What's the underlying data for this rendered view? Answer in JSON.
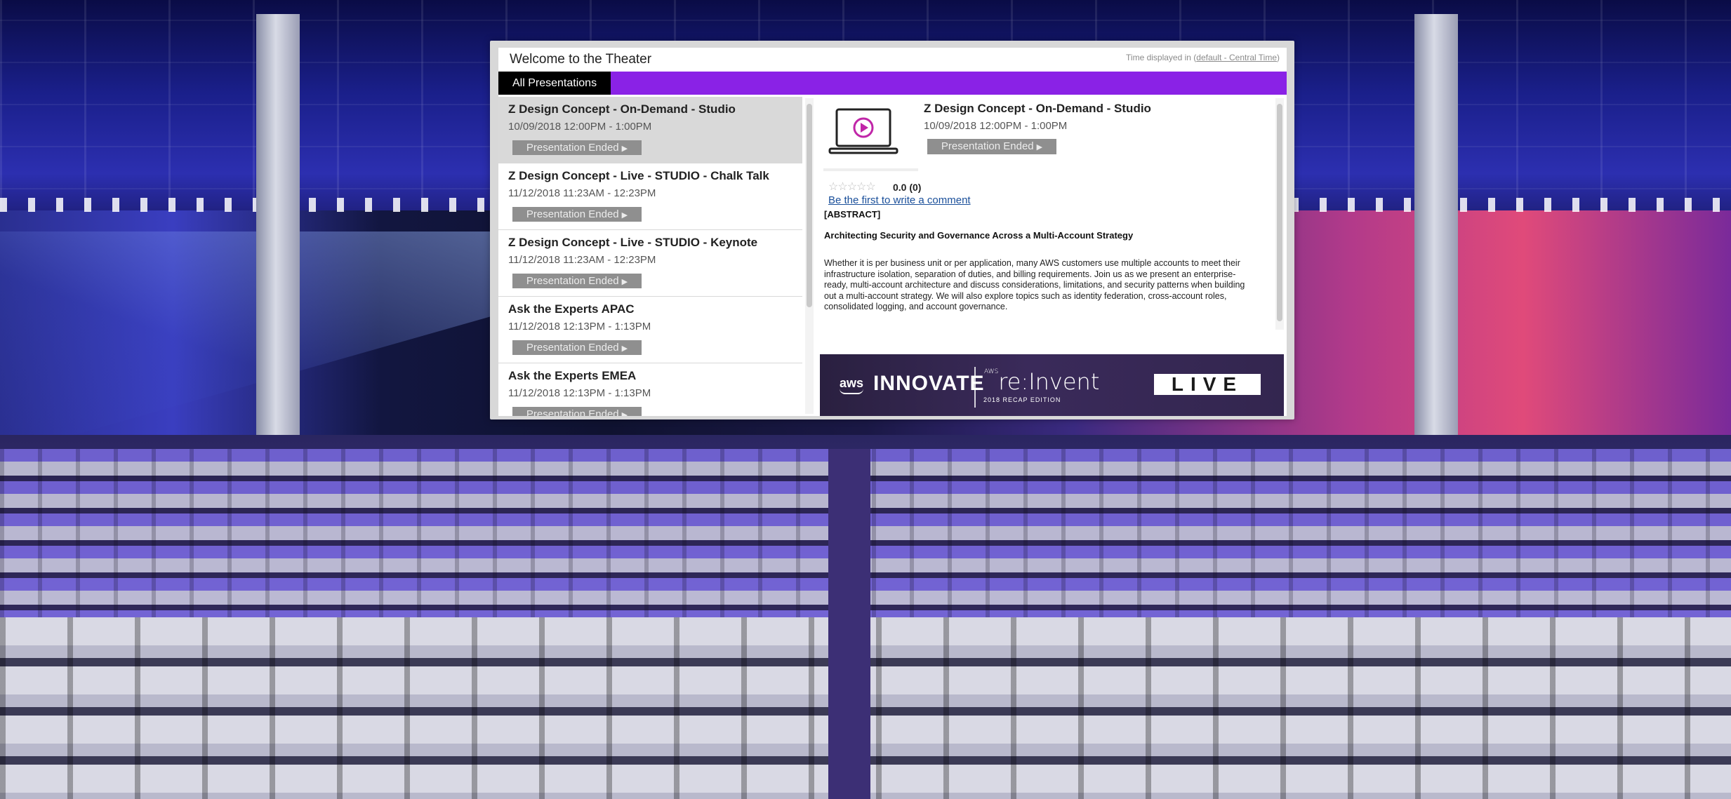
{
  "header": {
    "title": "Welcome to the Theater",
    "timezone_prefix": "Time displayed in (",
    "timezone_link": "default - Central Time",
    "timezone_suffix": ")"
  },
  "tabs": [
    {
      "label": "All Presentations",
      "active": true
    }
  ],
  "sessions": [
    {
      "title": "Z Design Concept - On-Demand - Studio",
      "time": "10/09/2018 12:00PM - 1:00PM",
      "status": "Presentation Ended",
      "selected": true
    },
    {
      "title": "Z Design Concept - Live - STUDIO - Chalk Talk",
      "time": "11/12/2018 11:23AM - 12:23PM",
      "status": "Presentation Ended",
      "selected": false
    },
    {
      "title": "Z Design Concept - Live - STUDIO - Keynote",
      "time": "11/12/2018 11:23AM - 12:23PM",
      "status": "Presentation Ended",
      "selected": false
    },
    {
      "title": "Ask the Experts APAC",
      "time": "11/12/2018 12:13PM - 1:13PM",
      "status": "Presentation Ended",
      "selected": false
    },
    {
      "title": "Ask the Experts EMEA",
      "time": "11/12/2018 12:13PM - 1:13PM",
      "status": "Presentation Ended",
      "selected": false
    }
  ],
  "detail": {
    "title": "Z Design Concept - On-Demand - Studio",
    "time": "10/09/2018 12:00PM - 1:00PM",
    "status": "Presentation Ended",
    "rating_stars": "☆☆☆☆☆",
    "rating_text": "0.0 (0)",
    "comment_link": "Be the first to write a comment",
    "abstract_heading": "[ABSTRACT]",
    "abstract_title": "Architecting Security and Governance Across a Multi-Account Strategy",
    "abstract_body": "Whether it is per business unit or per application, many AWS customers use multiple accounts to meet their infrastructure isolation, separation of duties, and billing requirements. Join us as we present an enterprise-ready, multi-account architecture and discuss considerations, limitations, and security patterns when building out a multi-account strategy. We will also explore topics such as identity federation, cross-account roles, consolidated logging, and account governance."
  },
  "banner": {
    "aws": "aws",
    "innovate": "INNOVATE",
    "reinvent_aws": "AWS",
    "reinvent": "re:Invent",
    "recap": "2018 RECAP EDITION",
    "live": "LIVE"
  },
  "colors": {
    "accent_purple": "#8a22e6",
    "tab_active": "#000000",
    "ended_button": "#8f8f8f",
    "link": "#1a4f9a"
  }
}
